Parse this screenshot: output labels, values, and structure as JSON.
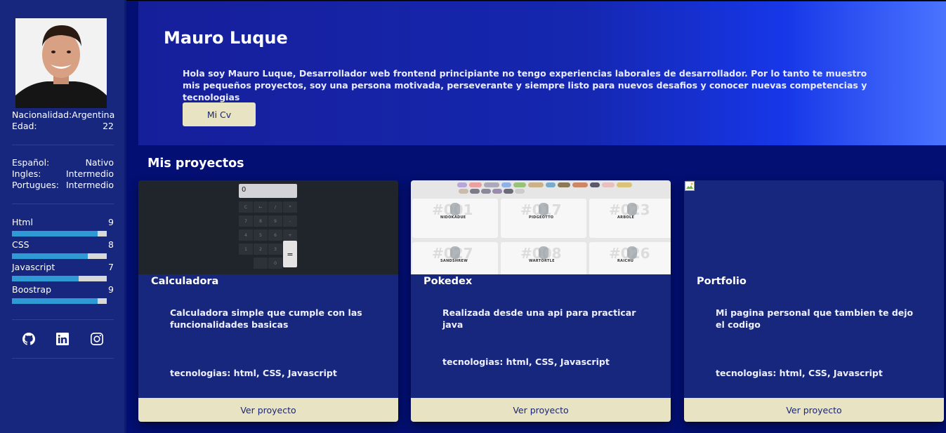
{
  "profile": {
    "nationality_label": "Nacionalidad:",
    "nationality_value": "Argentina",
    "age_label": "Edad:",
    "age_value": "22"
  },
  "languages": [
    {
      "name": "Español:",
      "level": "Nativo"
    },
    {
      "name": "Ingles:",
      "level": "Intermedio"
    },
    {
      "name": "Portugues:",
      "level": "Intermedio"
    }
  ],
  "skills": [
    {
      "name": "Html",
      "score": "9",
      "percent": 90
    },
    {
      "name": "CSS",
      "score": "8",
      "percent": 80
    },
    {
      "name": "Javascript",
      "score": "7",
      "percent": 70
    },
    {
      "name": "Boostrap",
      "score": "9",
      "percent": 90
    }
  ],
  "socials": [
    {
      "icon": "github-icon"
    },
    {
      "icon": "linkedin-icon"
    },
    {
      "icon": "instagram-icon"
    }
  ],
  "hero": {
    "name": "Mauro Luque",
    "bio": "Hola soy Mauro Luque, Desarrollador web frontend principiante no tengo experiencias laborales de desarrollador. Por lo tanto te muestro mis pequeños proyectos, soy una persona motivada, perseverante y siempre listo para nuevos desafios y conocer nuevas competencias y tecnologias",
    "cv_button": "Mi Cv"
  },
  "projects_title": "Mis proyectos",
  "projects": [
    {
      "title": "Calculadora",
      "description": "Calculadora simple que cumple con las funcionalidades basicas",
      "tech": "tecnologias: html, CSS, Javascript",
      "button": "Ver proyecto",
      "display_value": "0"
    },
    {
      "title": "Pokedex",
      "description": "Realizada desde una api para practicar java",
      "tech": "tecnologias: html, CSS, Javascript",
      "button": "Ver proyecto"
    },
    {
      "title": "Portfolio",
      "description": "Mi pagina personal que tambien te dejo el codigo",
      "tech": "tecnologias: html, CSS, Javascript",
      "button": "Ver proyecto"
    }
  ],
  "colors": {
    "background": "#030f72",
    "sidebar": "#17277d",
    "accent_button": "#e8e4c3",
    "skill_bar": "#2f9bd4"
  }
}
